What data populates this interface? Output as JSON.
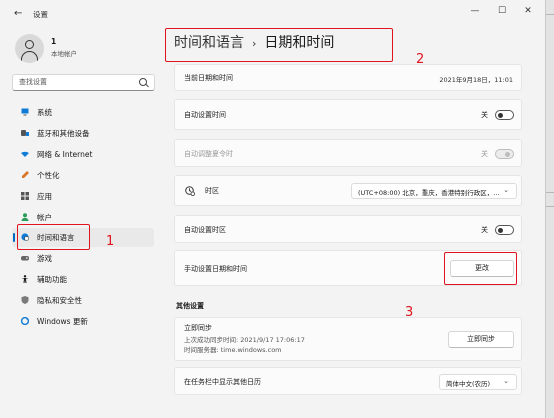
{
  "window": {
    "app_title": "设置",
    "back_glyph": "←",
    "minimize_glyph": "—",
    "maximize_glyph": "☐",
    "close_glyph": "✕"
  },
  "profile": {
    "name": "1",
    "account_type": "本地帐户"
  },
  "search": {
    "placeholder": "查找设置"
  },
  "sidebar": {
    "items": [
      {
        "label": "系统",
        "icon": "monitor-icon"
      },
      {
        "label": "蓝牙和其他设备",
        "icon": "bluetooth-icon"
      },
      {
        "label": "网络 & Internet",
        "icon": "wifi-icon"
      },
      {
        "label": "个性化",
        "icon": "brush-icon"
      },
      {
        "label": "应用",
        "icon": "apps-icon"
      },
      {
        "label": "帐户",
        "icon": "person-icon"
      },
      {
        "label": "时间和语言",
        "icon": "globe-clock-icon",
        "active": true
      },
      {
        "label": "游戏",
        "icon": "gamepad-icon"
      },
      {
        "label": "辅助功能",
        "icon": "accessibility-icon"
      },
      {
        "label": "隐私和安全性",
        "icon": "shield-icon"
      },
      {
        "label": "Windows 更新",
        "icon": "update-icon"
      }
    ]
  },
  "header": {
    "parent": "时间和语言",
    "separator": "›",
    "current": "日期和时间"
  },
  "settings": {
    "current_datetime": {
      "label": "当前日期和时间",
      "value": "2021年9月18日，11:01"
    },
    "auto_time": {
      "label": "自动设置时间",
      "state": "关"
    },
    "auto_dst": {
      "label": "自动调整夏令时",
      "state": "关"
    },
    "timezone": {
      "label": "时区",
      "value": "(UTC+08:00) 北京，重庆，香港特别行政区，..."
    },
    "auto_timezone": {
      "label": "自动设置时区",
      "state": "关"
    },
    "manual_set": {
      "label": "手动设置日期和时间",
      "button": "更改"
    }
  },
  "other": {
    "title": "其他设置",
    "sync": {
      "label": "立即同步",
      "last_sync": "上次成功同步时间: 2021/9/17 17:06:17",
      "server": "时间服务器: time.windows.com",
      "button": "立即同步"
    },
    "taskbar_calendar": {
      "label": "在任务栏中显示其他日历",
      "value": "简体中文(农历)"
    }
  },
  "annotations": {
    "n1": "1",
    "n2": "2",
    "n3": "3"
  },
  "colors": {
    "accent": "#0067c0",
    "annotation": "#e0141e"
  }
}
